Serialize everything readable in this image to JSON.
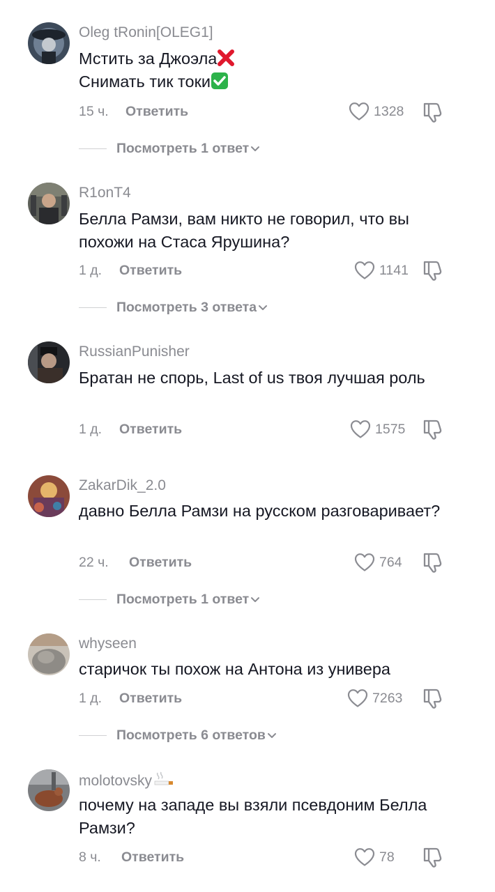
{
  "comments": [
    {
      "username": "Oleg tRonin[OLEG1]",
      "text_line1": "Мстить за Джоэла",
      "text_line2": "Снимать тик токи",
      "time": "15 ч.",
      "reply_label": "Ответить",
      "likes": "1328",
      "view_replies": "Посмотреть 1 ответ"
    },
    {
      "username": "R1onT4",
      "text": "Белла Рамзи, вам никто не говорил, что вы похожи на Стаса Ярушина?",
      "time": "1 д.",
      "reply_label": "Ответить",
      "likes": "1141",
      "view_replies": "Посмотреть 3 ответа"
    },
    {
      "username": "RussianPunisher",
      "text": "Братан не спорь, Last of us твоя лучшая роль",
      "time": "1 д.",
      "reply_label": "Ответить",
      "likes": "1575"
    },
    {
      "username": "ZakarDik_2.0",
      "text": "давно Белла Рамзи на русском разговаривает?",
      "time": "22 ч.",
      "reply_label": "Ответить",
      "likes": "764",
      "view_replies": "Посмотреть 1 ответ"
    },
    {
      "username": "whyseen",
      "text": "старичок ты похож на Антона из универа",
      "time": "1 д.",
      "reply_label": "Ответить",
      "likes": "7263",
      "view_replies": "Посмотреть 6 ответов"
    },
    {
      "username": "molotovsky",
      "text": "почему на западе вы взяли псевдоним Белла Рамзи?",
      "time": "8 ч.",
      "reply_label": "Ответить",
      "likes": "78"
    }
  ],
  "icons": {
    "cross": "cross-mark-icon",
    "check": "check-mark-icon",
    "heart": "heart-icon",
    "dislike": "thumbs-down-icon",
    "chevron": "chevron-down-icon",
    "cigarette": "cigarette-icon"
  },
  "colors": {
    "text": "#161823",
    "muted": "#8a8b91",
    "cross_red": "#e0182d",
    "check_green": "#2db24a"
  }
}
